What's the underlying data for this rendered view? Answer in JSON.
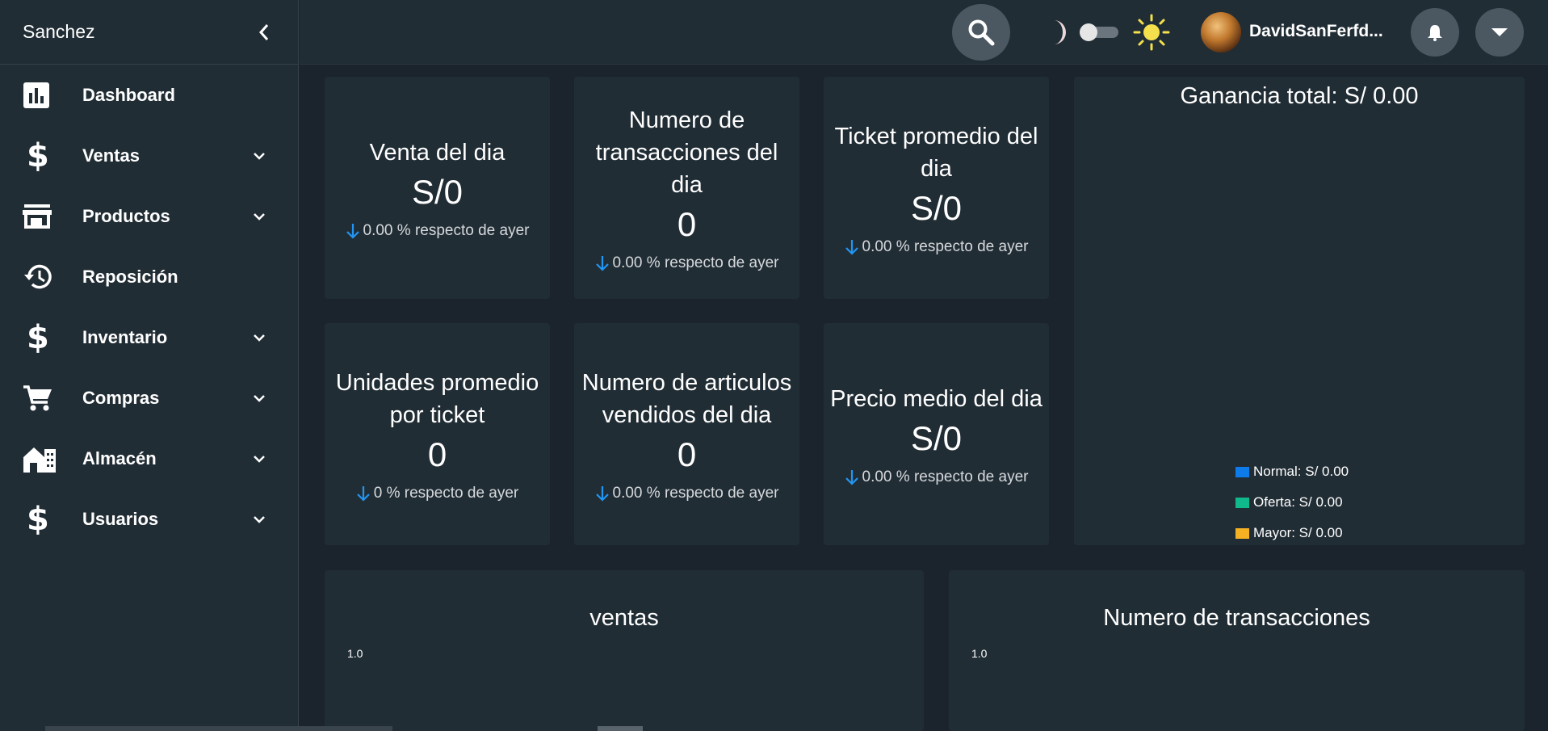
{
  "sidebar": {
    "brand": "Sanchez",
    "items": [
      {
        "label": "Dashboard",
        "icon": "bar-chart-icon"
      },
      {
        "label": "Ventas",
        "icon": "dollar-icon"
      },
      {
        "label": "Productos",
        "icon": "store-icon"
      },
      {
        "label": "Reposición",
        "icon": "history-icon"
      },
      {
        "label": "Inventario",
        "icon": "dollar-icon"
      },
      {
        "label": "Compras",
        "icon": "cart-icon"
      },
      {
        "label": "Almacén",
        "icon": "warehouse-icon"
      },
      {
        "label": "Usuarios",
        "icon": "dollar-icon"
      }
    ]
  },
  "topbar": {
    "username": "DavidSanFerfd..."
  },
  "cards": [
    {
      "title": "Venta del dia",
      "value": "S/0",
      "delta": "0.00 % respecto de ayer"
    },
    {
      "title": "Numero de transacciones del dia",
      "value": "0",
      "delta": "0.00 % respecto de ayer"
    },
    {
      "title": "Ticket promedio del dia",
      "value": "S/0",
      "delta": "0.00 % respecto de ayer"
    },
    {
      "title": "Unidades promedio por ticket",
      "value": "0",
      "delta": "0 % respecto de ayer"
    },
    {
      "title": "Numero de articulos vendidos del dia",
      "value": "0",
      "delta": "0.00 % respecto de ayer"
    },
    {
      "title": "Precio medio del dia",
      "value": "S/0",
      "delta": "0.00 % respecto de ayer"
    }
  ],
  "profit": {
    "title": "Ganancia total: S/ 0.00",
    "legend": [
      {
        "label": "Normal: S/ 0.00",
        "color": "#0d7bea"
      },
      {
        "label": "Oferta: S/ 0.00",
        "color": "#10b98a"
      },
      {
        "label": "Mayor: S/ 0.00",
        "color": "#f5b124"
      }
    ]
  },
  "charts": [
    {
      "title": "ventas",
      "tick": "1.0"
    },
    {
      "title": "Numero de transacciones",
      "tick": "1.0"
    }
  ],
  "colors": {
    "arrow": "#2196f3",
    "sun": "#f4e04d",
    "moon": "#ead8d8"
  }
}
